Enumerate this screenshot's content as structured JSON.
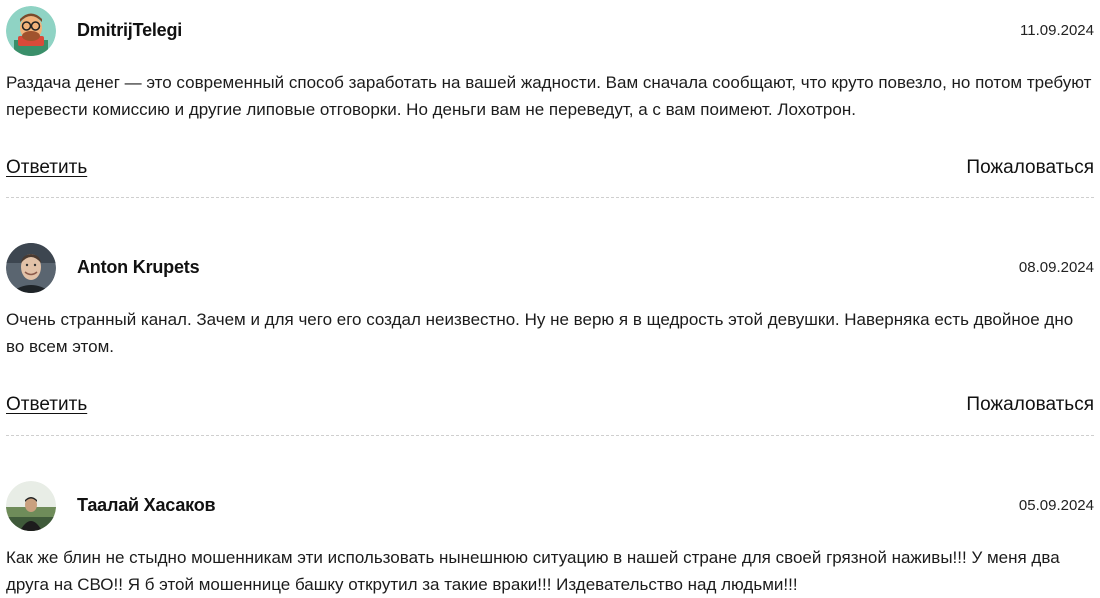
{
  "comments": [
    {
      "author": "DmitrijTelegi",
      "date": "11.09.2024",
      "text": "Раздача денег — это современный способ заработать на вашей жадности. Вам сначала сообщают, что круто повезло, но потом требуют перевести комиссию и другие липовые отговорки. Но деньги вам не переведут, а с вам поимеют. Лохотрон.",
      "reply_label": "Ответить",
      "report_label": "Пожаловаться"
    },
    {
      "author": "Anton Krupets",
      "date": "08.09.2024",
      "text": "Очень странный канал. Зачем и для чего его создал неизвестно. Ну не верю я в щедрость этой девушки. Наверняка есть двойное дно во всем этом.",
      "reply_label": "Ответить",
      "report_label": "Пожаловаться"
    },
    {
      "author": "Таалай Хасаков",
      "date": "05.09.2024",
      "text": "Как же блин не стыдно мошенникам эти использовать нынешнюю ситуацию в нашей стране для своей грязной наживы!!! У меня два друга на СВО!! Я б этой мошеннице башку открутил за такие враки!!! Издевательство над людьми!!!"
    }
  ]
}
